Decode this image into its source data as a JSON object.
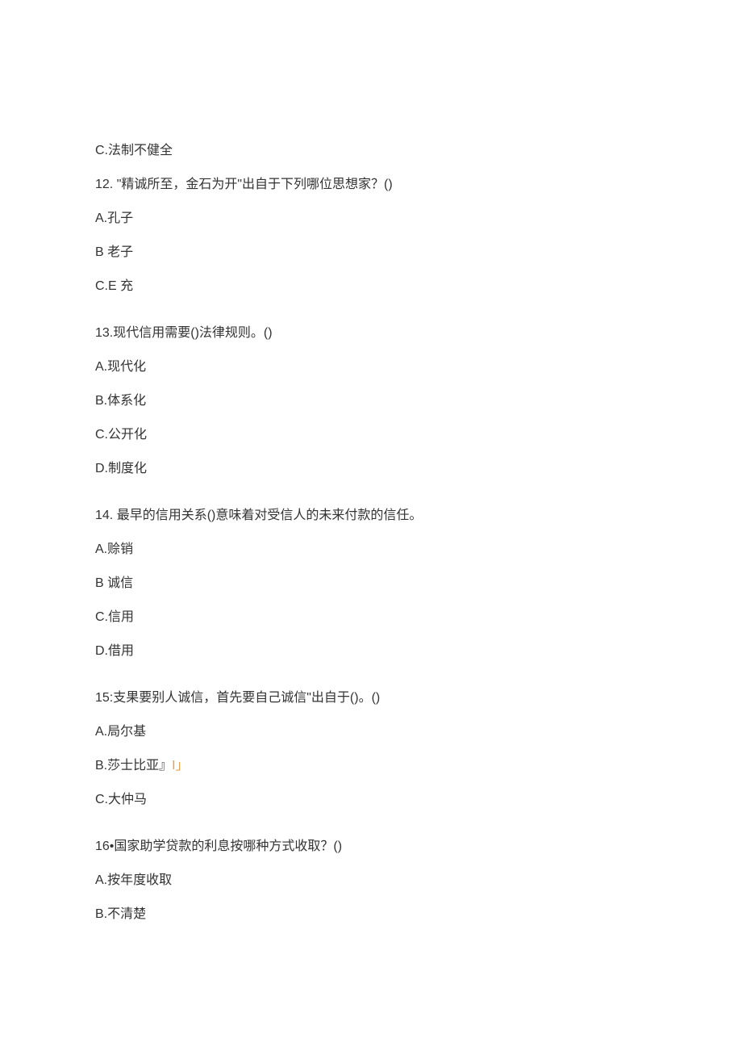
{
  "lines": [
    {
      "text": "C.法制不健全",
      "gap": false
    },
    {
      "text": "12. \"精诚所至，金石为开\"出自于下列哪位思想家？()",
      "gap": false
    },
    {
      "text": "A.孔子",
      "gap": false
    },
    {
      "text": "B 老子",
      "gap": false
    },
    {
      "text": "C.E 充",
      "gap": true
    },
    {
      "text": "13.现代信用需要()法律规则。()",
      "gap": false
    },
    {
      "text": "A.现代化",
      "gap": false
    },
    {
      "text": "B.体系化",
      "gap": false
    },
    {
      "text": "C.公开化",
      "gap": false
    },
    {
      "text": "D.制度化",
      "gap": true
    },
    {
      "text": "14. 最早的信用关系()意味着对受信人的未来付款的信任。",
      "gap": false
    },
    {
      "text": "A.赊销",
      "gap": false
    },
    {
      "text": "B 诚信",
      "gap": false
    },
    {
      "text": "C.信用",
      "gap": false
    },
    {
      "text": "D.借用",
      "gap": true
    },
    {
      "text": "15:支果要别人诚信，首先要自己诚信\"出自于()。()",
      "gap": false
    },
    {
      "text": "A.局尔基",
      "gap": false
    },
    {
      "text": "B.莎士比亚』",
      "suffix": "I」",
      "gap": false
    },
    {
      "text": "C.大仲马",
      "gap": true
    },
    {
      "text": "16•国家助学贷款的利息按哪种方式收取？()",
      "gap": false
    },
    {
      "text": "A.按年度收取",
      "gap": false
    },
    {
      "text": "B.不清楚",
      "gap": false
    }
  ]
}
